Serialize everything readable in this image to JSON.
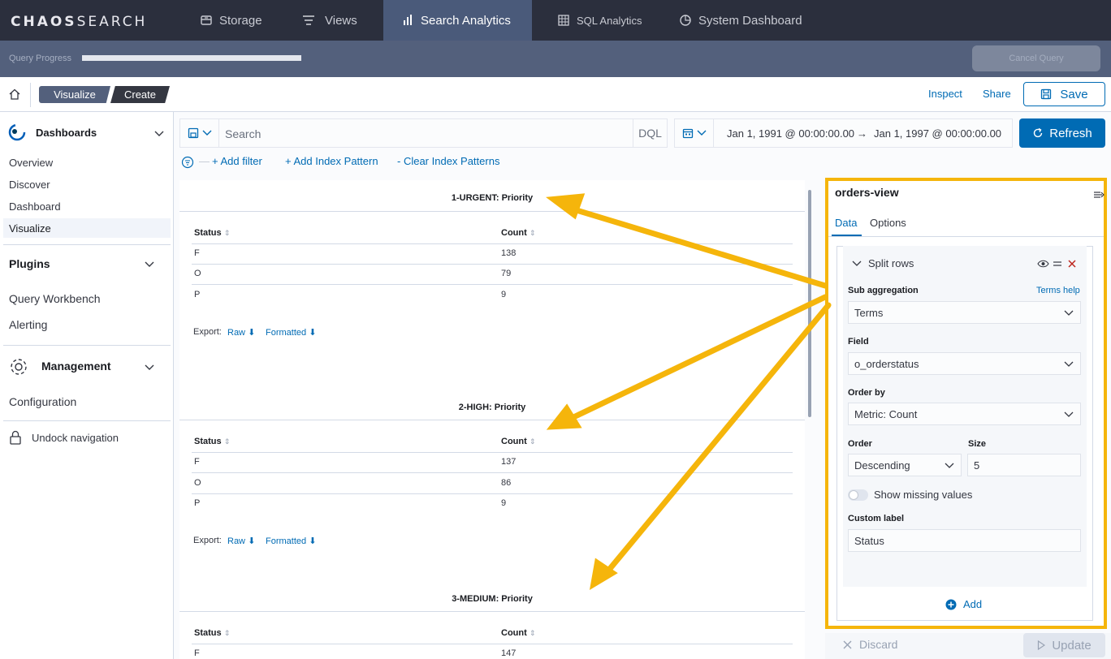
{
  "app": {
    "logo_bold": "CHAOS",
    "logo_rest": "SEARCH"
  },
  "topnav": {
    "tabs": [
      {
        "label": "Storage",
        "icon": "storage-icon"
      },
      {
        "label": "Views",
        "icon": "views-icon"
      },
      {
        "label": "Search Analytics",
        "icon": "bar-chart-icon"
      },
      {
        "label": "SQL Analytics",
        "icon": "table-icon"
      },
      {
        "label": "System Dashboard",
        "icon": "dashboard-icon"
      }
    ]
  },
  "progress": {
    "label": "Query Progress",
    "cancel_label": "Cancel Query"
  },
  "breadcrumbs": [
    "Visualize",
    "Create"
  ],
  "toolbar": {
    "inspect": "Inspect",
    "share": "Share",
    "save": "Save"
  },
  "sidebar": {
    "dashboards": {
      "title": "Dashboards",
      "items": [
        "Overview",
        "Discover",
        "Dashboard",
        "Visualize"
      ]
    },
    "plugins": {
      "title": "Plugins",
      "items": [
        "Query Workbench",
        "Alerting"
      ]
    },
    "management": {
      "title": "Management",
      "items": [
        "Configuration"
      ]
    },
    "undock": "Undock navigation"
  },
  "query": {
    "placeholder": "Search",
    "language": "DQL"
  },
  "date": {
    "start": "Jan 1, 1991 @ 00:00:00.00",
    "arrow": "→",
    "end": "Jan 1, 1997 @ 00:00:00.00"
  },
  "refresh": "Refresh",
  "filters": {
    "add_filter": "+ Add filter",
    "add_index": "+ Add Index Pattern",
    "clear_index": "- Clear Index Patterns"
  },
  "tables": [
    {
      "title": "1-URGENT: Priority",
      "headers": [
        "Status",
        "Count"
      ],
      "rows": [
        [
          "F",
          "138"
        ],
        [
          "O",
          "79"
        ],
        [
          "P",
          "9"
        ]
      ],
      "export": "Export:",
      "raw": "Raw",
      "formatted": "Formatted"
    },
    {
      "title": "2-HIGH: Priority",
      "headers": [
        "Status",
        "Count"
      ],
      "rows": [
        [
          "F",
          "137"
        ],
        [
          "O",
          "86"
        ],
        [
          "P",
          "9"
        ]
      ],
      "export": "Export:",
      "raw": "Raw",
      "formatted": "Formatted"
    },
    {
      "title": "3-MEDIUM: Priority",
      "headers": [
        "Status",
        "Count"
      ],
      "rows": [
        [
          "F",
          "147"
        ]
      ]
    }
  ],
  "panel": {
    "title": "orders-view",
    "tabs": [
      "Data",
      "Options"
    ],
    "split_rows": "Split rows",
    "sub_agg_label": "Sub aggregation",
    "terms_help": "Terms help",
    "sub_agg_value": "Terms",
    "field_label": "Field",
    "field_value": "o_orderstatus",
    "order_by_label": "Order by",
    "order_by_value": "Metric: Count",
    "order_label": "Order",
    "order_value": "Descending",
    "size_label": "Size",
    "size_value": "5",
    "show_missing": "Show missing values",
    "custom_label": "Custom label",
    "custom_value": "Status",
    "add": "Add",
    "discard": "Discard",
    "update": "Update"
  },
  "colors": {
    "topnav": "#2b2f3d",
    "accent": "#006bb4",
    "annotation": "#f5b50b",
    "danger": "#bd271e"
  }
}
